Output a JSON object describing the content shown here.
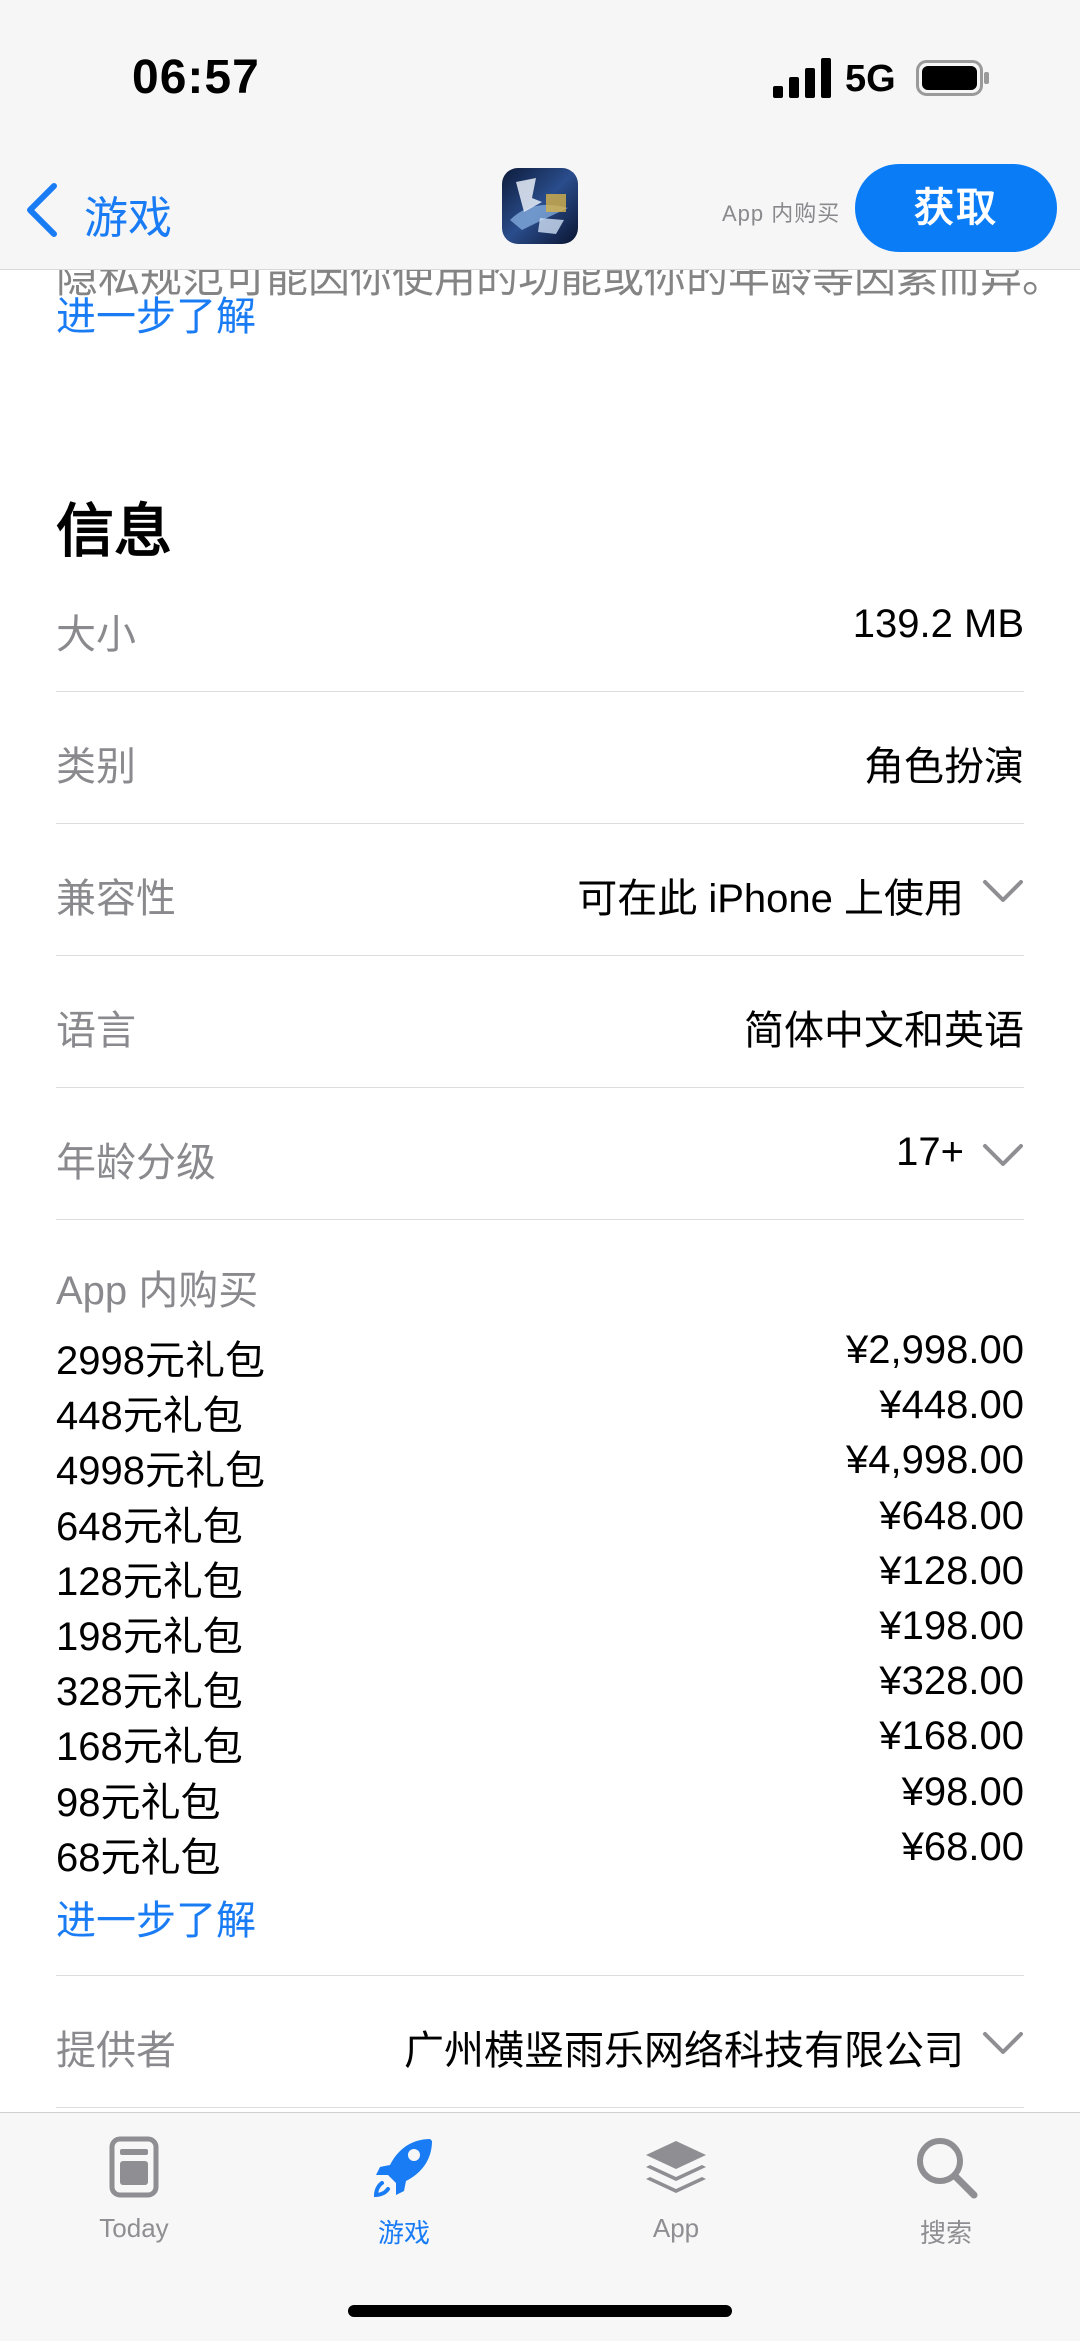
{
  "status_bar": {
    "time": "06:57",
    "network": "5G"
  },
  "nav": {
    "back_label": "游戏",
    "iap_note": "App 内购买",
    "get_label": "获取"
  },
  "top": {
    "cut_text": "隐私规范可能因你使用的功能或你的年龄等因素而异。",
    "learn_more": "进一步了解"
  },
  "info": {
    "title": "信息",
    "rows": [
      {
        "label": "大小",
        "value": "139.2 MB"
      },
      {
        "label": "类别",
        "value": "角色扮演"
      },
      {
        "label": "兼容性",
        "value": "可在此 iPhone 上使用"
      },
      {
        "label": "语言",
        "value": "简体中文和英语"
      },
      {
        "label": "年龄分级",
        "value": "17+"
      }
    ],
    "iap": {
      "title": "App 内购买",
      "items": [
        {
          "name": "2998元礼包",
          "price": "¥2,998.00"
        },
        {
          "name": "448元礼包",
          "price": "¥448.00"
        },
        {
          "name": "4998元礼包",
          "price": "¥4,998.00"
        },
        {
          "name": "648元礼包",
          "price": "¥648.00"
        },
        {
          "name": "128元礼包",
          "price": "¥128.00"
        },
        {
          "name": "198元礼包",
          "price": "¥198.00"
        },
        {
          "name": "328元礼包",
          "price": "¥328.00"
        },
        {
          "name": "168元礼包",
          "price": "¥168.00"
        },
        {
          "name": "98元礼包",
          "price": "¥98.00"
        },
        {
          "name": "68元礼包",
          "price": "¥68.00"
        }
      ],
      "learn_more": "进一步了解"
    },
    "provider": {
      "label": "提供者",
      "value": "广州横竖雨乐网络科技有限公司"
    }
  },
  "tabs": [
    {
      "label": "Today",
      "icon": "today-icon",
      "active": false
    },
    {
      "label": "游戏",
      "icon": "rocket-icon",
      "active": true
    },
    {
      "label": "App",
      "icon": "layers-icon",
      "active": false
    },
    {
      "label": "搜索",
      "icon": "search-icon",
      "active": false
    }
  ],
  "colors": {
    "accent": "#1a7cf5",
    "get_button": "#0a7cf6",
    "secondary_text": "#8a8a8e"
  }
}
